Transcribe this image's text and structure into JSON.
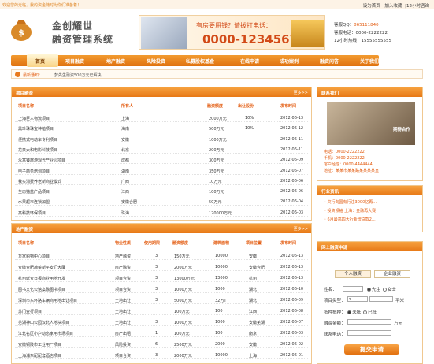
{
  "top": {
    "welcome": "欢迎您的光临，我的资金随时为你们准备着！",
    "links": [
      "设为首页",
      "|加入收藏",
      "|12小时咨询"
    ]
  },
  "logo": {
    "line1": "金创耀世",
    "line2": "融资管理系统"
  },
  "banner": {
    "ask": "有房要用钱？请拨打电话：",
    "phone": "0000-1234567"
  },
  "contact": [
    {
      "label": "客服QQ：",
      "value": "865111840"
    },
    {
      "label": "客服电话：",
      "value": "0000-2222222"
    },
    {
      "label": "12小时热线：",
      "value": "15555555555"
    }
  ],
  "nav": [
    "首页",
    "项目融资",
    "地产融资",
    "风险投资",
    "私募股权基金",
    "在线申请",
    "成功案例",
    "融资问答",
    "关于我们"
  ],
  "notice": {
    "label": "最新通知：",
    "text": "梦先生融资500万元已解决"
  },
  "project_panel": {
    "title": "项目融资",
    "more": "更多>>",
    "headers": [
      "项目名称",
      "所有人",
      "融资额度",
      "出让股份",
      "发布时间"
    ],
    "rows": [
      [
        "上海巨人物流项目",
        "上海",
        "2000万元",
        "10%",
        "2012-06-13"
      ],
      [
        "黑珍珠珠宝种植项目",
        "海南",
        "500万元",
        "10%",
        "2012-06-12"
      ],
      [
        "便携式电动车专利项目",
        "安徽",
        "1000万元",
        "",
        "2012-06-11"
      ],
      [
        "龙泉太和电影科技项目",
        "北京",
        "200万元",
        "",
        "2012-06-11"
      ],
      [
        "永富钱旅游观光产业园项目",
        "成都",
        "300万元",
        "",
        "2012-06-09"
      ],
      [
        "电子商务培训项目",
        "湖南",
        "350万元",
        "",
        "2012-06-07"
      ],
      [
        "我买消费养老新商业模式",
        "广西",
        "10万元",
        "",
        "2012-06-06"
      ],
      [
        "生态猫蓝产品项目",
        "江西",
        "100万元",
        "",
        "2012-06-06"
      ],
      [
        "水果超市连锁加盟",
        "安徽合肥",
        "50万元",
        "",
        "2012-06-04"
      ],
      [
        "高科技环保项目",
        "珠海",
        "120000万元",
        "",
        "2012-06-03"
      ]
    ]
  },
  "estate_panel": {
    "title": "地产融资",
    "more": "更多>>",
    "headers": [
      "项目名称",
      "物业性质",
      "使用期限",
      "融资额度",
      "建筑面积",
      "项目位置",
      "发布时间"
    ],
    "rows": [
      [
        "万家购物中心项目",
        "地产融资",
        "3",
        "150万元",
        "10000",
        "安徽",
        "2012-06-13"
      ],
      [
        "安徽合肥蔬菜新平安汇大厦",
        "房产融资",
        "3",
        "2000万元",
        "10000",
        "安徽合肥",
        "2012-06-13"
      ],
      [
        "杭州延安日报商业用地开发",
        "项目合资",
        "3",
        "13000万元",
        "13000",
        "杭州",
        "2012-06-13"
      ],
      [
        "图书文化公馆案融图书项目",
        "项目合资",
        "3",
        "1000万元",
        "1000",
        "湖北",
        "2012-06-10"
      ],
      [
        "深圳市东环路车辆商用地出让项目",
        "土地出让",
        "3",
        "5000万元",
        "32万T",
        "湖北",
        "2012-06-09"
      ],
      [
        "苏门亚行项目",
        "土地出让",
        "",
        "100万元",
        "100",
        "江西",
        "2012-06-08"
      ],
      [
        "芜湖神山公园汉北人地块项目",
        "土地出让",
        "3",
        "1000万元",
        "1000",
        "安徽芜湖",
        "2012-06-07"
      ],
      [
        "江北名区小户动态家用市场项目",
        "房产出租",
        "1",
        "100万元",
        "100",
        "南京",
        "2012-06-03"
      ],
      [
        "安徽铜陵市工业用厂项目",
        "风险投资",
        "6",
        "2500万元",
        "2000",
        "安徽",
        "2012-06-02"
      ],
      [
        "上海浦东配配套酒店项目",
        "项目合资",
        "3",
        "2000万元",
        "10000",
        "上海",
        "2012-06-01"
      ]
    ]
  },
  "contact_box": {
    "title": "联系我们",
    "image_caption": "期待合作",
    "lines": [
      "电话：0000-2222222",
      "手机：0000-2222222",
      "客户经理：0000-4444444",
      "地址：某某市某某路某某某某室"
    ]
  },
  "industry_box": {
    "title": "行业资讯",
    "items": [
      "央行向国有行注3000亿再...",
      "投资领袖 上海：金融再大赛",
      "6月最高四大行新增贷款2..."
    ]
  },
  "apply_box": {
    "title": "网上融资申请",
    "tabs": [
      "个人融资",
      "企业融资"
    ],
    "name_label": "姓名：",
    "gender_m": "先生",
    "gender_f": "女士",
    "type_label": "项目类型：",
    "area_label": "",
    "area_unit": "平米",
    "collateral_label": "抵押抵押：",
    "collateral_yes": "未抵",
    "collateral_no": "已抵",
    "amount_label": "融资金额：",
    "amount_unit": "万元",
    "phone_label": "联系电话：",
    "submit": "提交申请"
  }
}
